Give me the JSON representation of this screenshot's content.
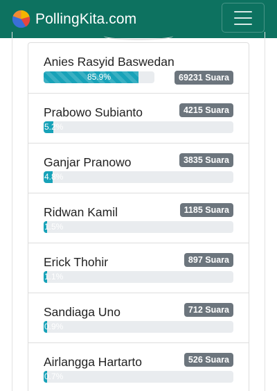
{
  "header": {
    "brand_text": "PollingKita.com",
    "logo_icon": "pie-chart-logo",
    "menu_icon": "hamburger-menu-icon",
    "colors": {
      "navbar": "#0d7260",
      "badge": "#6c757d",
      "bar": "#17a2b8",
      "track": "#e9ecef"
    }
  },
  "candidates": [
    {
      "name": "Anies Rasyid Baswedan",
      "votes": "69231 Suara",
      "percent": "85.9%",
      "fraction": 0.859
    },
    {
      "name": "Prabowo Subianto",
      "votes": "4215 Suara",
      "percent": "5.2%",
      "fraction": 0.052
    },
    {
      "name": "Ganjar Pranowo",
      "votes": "3835 Suara",
      "percent": "4.8%",
      "fraction": 0.048
    },
    {
      "name": "Ridwan Kamil",
      "votes": "1185 Suara",
      "percent": "1.5%",
      "fraction": 0.015
    },
    {
      "name": "Erick Thohir",
      "votes": "897 Suara",
      "percent": "1.1%",
      "fraction": 0.011
    },
    {
      "name": "Sandiaga Uno",
      "votes": "712 Suara",
      "percent": "0.9%",
      "fraction": 0.009
    },
    {
      "name": "Airlangga Hartarto",
      "votes": "526 Suara",
      "percent": "0.7%",
      "fraction": 0.007
    }
  ]
}
